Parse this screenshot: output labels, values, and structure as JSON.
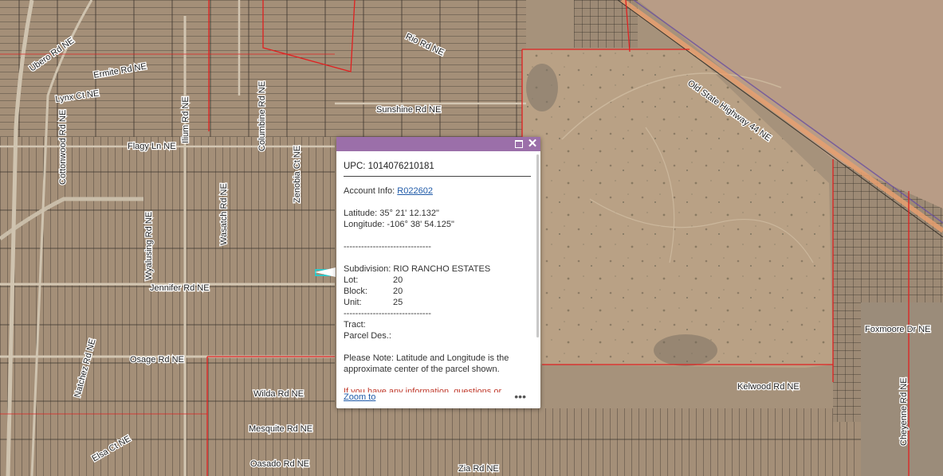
{
  "map": {
    "road_labels": [
      "Ubero Rd NE",
      "Lynx Ct NE",
      "Ermite Rd NE",
      "Cottonwood Rd NE",
      "Flagy Ln NE",
      "Wyalusing Rd NE",
      "Ilium Rd NE",
      "Wasatch Rd NE",
      "Columbine Rd NE",
      "Zenobia Ct NE",
      "Sunshine Rd NE",
      "Old State Highway 44 NE",
      "Jennifer Rd NE",
      "Osage Rd NE",
      "Wilda Rd NE",
      "Mesquite Rd NE",
      "Oasado Rd NE",
      "Elsa Ct NE",
      "Kelwood Rd NE",
      "Foxmoore Dr NE",
      "Zia Rd NE",
      "Cheyenne Rd NE",
      "Natchez Rd NE",
      "Rio Rd NE"
    ]
  },
  "popup": {
    "upc": "UPC: 1014076210181",
    "account_label": "Account Info:",
    "account_link": "R022602",
    "latitude": "Latitude: 35° 21' 12.132\"",
    "longitude": "Longitude: -106° 38' 54.125\"",
    "separator1": "------------------------------",
    "subdivision": "Subdivision: RIO RANCHO ESTATES",
    "lot_label": "Lot:",
    "lot_value": "20",
    "block_label": "Block:",
    "block_value": "20",
    "unit_label": "Unit:",
    "unit_value": "25",
    "separator2": "------------------------------",
    "tract": "Tract:",
    "parcel_des": "Parcel Des.:",
    "note_line1": "Please Note: Latitude and Longitude is the",
    "note_line2": "approximate center of the parcel shown.",
    "info_text": "If you have any information, questions or",
    "zoom_link": "Zoom to",
    "more": "•••",
    "close": "✕",
    "maximize": "maximize"
  },
  "colors": {
    "header": "#9b6fa9",
    "link": "#1f5aa8",
    "info_text": "#c0392b",
    "parcel_line": "#3a342c",
    "boundary": "#e02020"
  }
}
